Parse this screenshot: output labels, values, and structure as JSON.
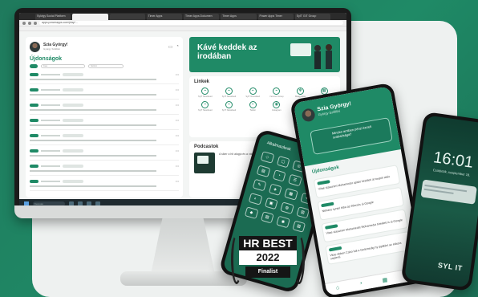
{
  "browser": {
    "tabs": [
      "Sylvigy Social Platform",
      "",
      "",
      "Timer Apps",
      "Timer Apps Dokumen",
      "Timer Apps",
      "Power Apps Timer",
      "SyIT GIT Group",
      "",
      "",
      ""
    ],
    "url": "apps.powerapps.com/play/..."
  },
  "profile": {
    "name": "Szia György!",
    "subtitle": "György Szőllősi"
  },
  "feed": {
    "title": "Újdonságok",
    "search_placeholder": "Kés",
    "filter_placeholder": "Szűrő"
  },
  "banner": {
    "text": "Kávé keddek az irodában"
  },
  "links": {
    "title": "Linkek",
    "items": [
      {
        "label": "SyIT Newsfeed",
        "icon": "link-icon"
      },
      {
        "label": "SyIT Newsfeed",
        "icon": "link-icon"
      },
      {
        "label": "SyIT Newsfeed",
        "icon": "link-icon"
      },
      {
        "label": "Yammer Group",
        "icon": "link-icon"
      },
      {
        "label": "Beágyazás",
        "icon": "snowflake-icon"
      },
      {
        "label": "Kalendárium",
        "icon": "calendar-icon"
      },
      {
        "label": "SyIT Newsfeed",
        "icon": "link-icon"
      },
      {
        "label": "SyIT Newsfeed",
        "icon": "link-icon"
      },
      {
        "label": "Twitter",
        "icon": "link-icon"
      },
      {
        "label": "Instagram",
        "icon": "camera-icon"
      },
      {
        "label": "Facebook",
        "icon": "link-icon"
      },
      {
        "label": "LinkedIn",
        "icon": "link-icon"
      }
    ]
  },
  "podcasts": {
    "title": "Podcastok",
    "text": "A siker a hit alapja és a vállalat gondolatlnak. 1. rész. ...",
    "button": "Csatlakozás"
  },
  "taskbar": {
    "search": "Keresés",
    "clock": "10:27"
  },
  "phone_left": {
    "title": "Alkalmazások"
  },
  "phone_mid": {
    "name": "Szia György!",
    "subtitle": "György Szőllősi",
    "card": "Minden amiben pénzt kezelt szabadsága?",
    "section": "Újdonságok",
    "items": [
      "Vitae stasuram Mohamedst apiski hirekleti at toupot alaiv",
      "Néhány syntel hiba az étkezés ai Google",
      "Vitae stasuram Mohamedst Mohamedst hirekleti is ai Google",
      "Vitae ebben Cairo bal a Gelemedig hy ippillánt az ekkora sapienti"
    ]
  },
  "phone_right": {
    "time": "16:01",
    "date": "Csütörtök, szeptember 18.",
    "logo": "SYL IT"
  },
  "award": {
    "line1": "HR BEST",
    "year": "2022",
    "label": "Finalist"
  }
}
